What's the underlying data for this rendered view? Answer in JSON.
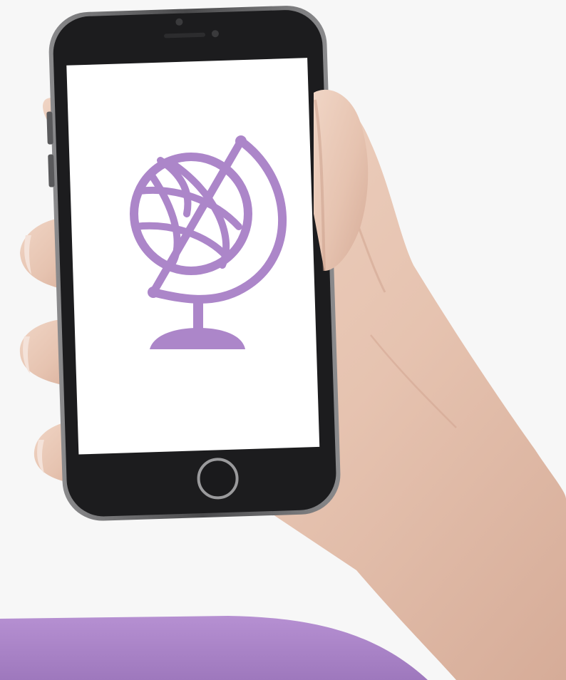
{
  "scene": {
    "subject": "hand-holding-phone",
    "screen_icon": "globe-icon"
  },
  "colors": {
    "background": "#f7f7f7",
    "icon_purple": "#ac86c9",
    "band_purple": "#a884c6",
    "phone_body": "#1c1c1e",
    "phone_frame": "#6f6f70",
    "screen": "#ffffff",
    "skin": "#e8c8b6",
    "skin_shadow": "#c99e8a"
  }
}
